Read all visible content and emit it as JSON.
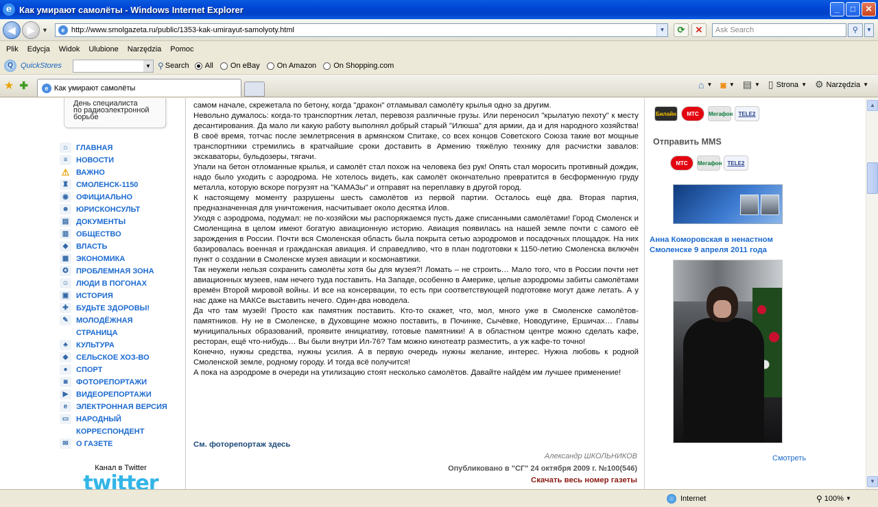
{
  "window": {
    "title": "Как умирают самолёты - Windows Internet Explorer",
    "minimize": "_",
    "maximize": "□",
    "close": "✕"
  },
  "address": {
    "url": "http://www.smolgazeta.ru/public/1353-kak-umirayut-samolyoty.html",
    "search_placeholder": "Ask Search"
  },
  "menu": [
    "Plik",
    "Edycja",
    "Widok",
    "Ulubione",
    "Narzędzia",
    "Pomoc"
  ],
  "quickstores": {
    "name": "QuickStores",
    "search_label": "Search",
    "options": [
      "All",
      "On eBay",
      "On Amazon",
      "On Shopping.com"
    ]
  },
  "tab": {
    "label": "Как умирают самолёты"
  },
  "commandbar": {
    "page_label": "Strona",
    "tools_label": "Narzędzia"
  },
  "left": {
    "callout_lines": [
      "День специалиста",
      "по радиоэлектронной",
      "борьбе"
    ],
    "nav": [
      {
        "label": "ГЛАВНАЯ",
        "icon": "home-icon",
        "glyph": "⌂"
      },
      {
        "label": "НОВОСТИ",
        "icon": "news-icon",
        "glyph": "≡"
      },
      {
        "label": "ВАЖНО",
        "icon": "warning-icon",
        "glyph": "⚠"
      },
      {
        "label": "СМОЛЕНСК-1150",
        "icon": "city-icon",
        "glyph": "♜"
      },
      {
        "label": "ОФИЦИАЛЬНО",
        "icon": "official-icon",
        "glyph": "◉"
      },
      {
        "label": "ЮРИСКОНСУЛЬТ",
        "icon": "people-icon",
        "glyph": "☻"
      },
      {
        "label": "ДОКУМЕНТЫ",
        "icon": "document-icon",
        "glyph": "▤"
      },
      {
        "label": "ОБЩЕСТВО",
        "icon": "society-icon",
        "glyph": "▥"
      },
      {
        "label": "ВЛАСТЬ",
        "icon": "power-icon",
        "glyph": "◆"
      },
      {
        "label": "ЭКОНОМИКА",
        "icon": "economy-icon",
        "glyph": "▦"
      },
      {
        "label": "ПРОБЛЕМНАЯ ЗОНА",
        "icon": "problem-icon",
        "glyph": "✪"
      },
      {
        "label": "ЛЮДИ В ПОГОНАХ",
        "icon": "soldier-icon",
        "glyph": "☺"
      },
      {
        "label": "ИСТОРИЯ",
        "icon": "history-icon",
        "glyph": "▣"
      },
      {
        "label": "БУДЬТЕ ЗДОРОВЫ!",
        "icon": "health-icon",
        "glyph": "✚"
      },
      {
        "label": "МОЛОДЁЖНАЯ СТРАНИЦА",
        "icon": "youth-icon",
        "glyph": "✎"
      },
      {
        "label": "КУЛЬТУРА",
        "icon": "culture-icon",
        "glyph": "♣"
      },
      {
        "label": "СЕЛЬСКОЕ ХОЗ-ВО",
        "icon": "agriculture-icon",
        "glyph": "◆"
      },
      {
        "label": "СПОРТ",
        "icon": "sport-icon",
        "glyph": "●"
      },
      {
        "label": "ФОТОРЕПОРТАЖИ",
        "icon": "camera-icon",
        "glyph": "◙"
      },
      {
        "label": "ВИДЕОРЕПОРТАЖИ",
        "icon": "video-icon",
        "glyph": "▶"
      },
      {
        "label": "ЭЛЕКТРОННАЯ ВЕРСИЯ",
        "icon": "e-version-icon",
        "glyph": "e"
      },
      {
        "label": "НАРОДНЫЙ КОРРЕСПОНДЕНТ",
        "icon": "monitor-icon",
        "glyph": "▭"
      },
      {
        "label": "О ГАЗЕТЕ",
        "icon": "newspaper-icon",
        "glyph": "✉"
      }
    ],
    "twitter_caption": "Канал в Twitter",
    "twitter_logo": "twitter"
  },
  "article": {
    "paragraphs": [
      "самом начале, скрежетала по бетону, когда \"дракон\" отламывал самолёту крылья одно за другим.",
      "Невольно думалось: когда-то транспортник летал, перевозя различные грузы. Или переносил \"крылатую пехоту\" к месту десантирования. Да мало ли какую работу выполнял добрый старый \"Илюша\" для армии, да и для народного хозяйства! В своё время, тотчас после землетрясения в армянском Спитаке, со всех концов Советского Союза такие вот мощные транспортники стремились в кратчайшие сроки доставить в Армению тяжёлую технику для расчистки завалов: экскаваторы, бульдозеры, тягачи.",
      "Упали на бетон отломанные крылья, и самолёт стал похож на человека без рук! Опять стал моросить противный дождик, надо было уходить с аэродрома. Не хотелось видеть, как самолёт окончательно превратится в бесформенную груду металла, которую вскоре погрузят на \"КАМАЗы\" и отправят на переплавку в другой город.",
      "К настоящему моменту разрушены шесть самолётов из первой партии. Осталось ещё два. Вторая партия, предназначенная для уничтожения, насчитывает около десятка Илов.",
      "Уходя с аэродрома, подумал: не по-хозяйски мы распоряжаемся пусть даже списанными самолётами! Город Смоленск и Смоленщина в целом имеют богатую авиационную историю. Авиация появилась на нашей земле почти с самого её зарождения в России. Почти вся Смоленская область была покрыта сетью аэродромов и посадочных площадок. На них базировалась военная и гражданская авиация. И справедливо, что в план подготовки к 1150-летию Смоленска включён пункт о создании в Смоленске музея авиации и космонавтики.",
      "Так неужели нельзя сохранить самолёты хотя бы для музея?! Ломать – не строить… Мало того, что в России почти нет авиационных музеев, нам нечего туда поставить. На Западе, особенно в Америке, целые аэродромы забиты самолётами времён Второй мировой войны. И все на консервации, то есть при соответствующей подготовке могут даже летать. А у нас даже на МАКСе выставить нечего. Один-два новодела.",
      "Да что там музей! Просто как памятник поставить. Кто-то скажет, что, мол, много уже в Смоленске самолётов-памятников. Ну не в Смоленске, в Духовщине можно поставить, в Починке, Сычёвке, Новодугине, Ершичах… Главы муниципальных образований, проявите инициативу, готовые памятники! А в областном центре можно сделать кафе, ресторан, ещё что-нибудь… Вы были внутри Ил-76? Там можно кинотеатр разместить, а уж кафе-то точно!",
      "Конечно, нужны средства, нужны усилия. А в первую очередь нужны желание, интерес. Нужна любовь к родной Смоленской земле, родному городу. И тогда всё получится!",
      "А пока на аэродроме в очереди на утилизацию стоят несколько самолётов. Давайте найдём им лучшее применение!"
    ],
    "photo_link": "См. фоторепортаж здесь",
    "author": "Александр ШКОЛЬНИКОВ",
    "published": "Опубликовано в \"СГ\" 24 октября 2009 г. №100(546)",
    "download": "Скачать весь номер газеты"
  },
  "right": {
    "operators_top": [
      "Билайн",
      "МТС",
      "Мегафон",
      "TELE2"
    ],
    "mms_heading": "Отправить MMS",
    "operators_mms": [
      "МТС",
      "Мегафон",
      "TELE2"
    ],
    "photo_caption": "Анна Коморовская в ненастном Смоленске 9 апреля 2011 года",
    "view_link": "Смотреть"
  },
  "status": {
    "zone": "Internet",
    "zoom": "100%"
  }
}
